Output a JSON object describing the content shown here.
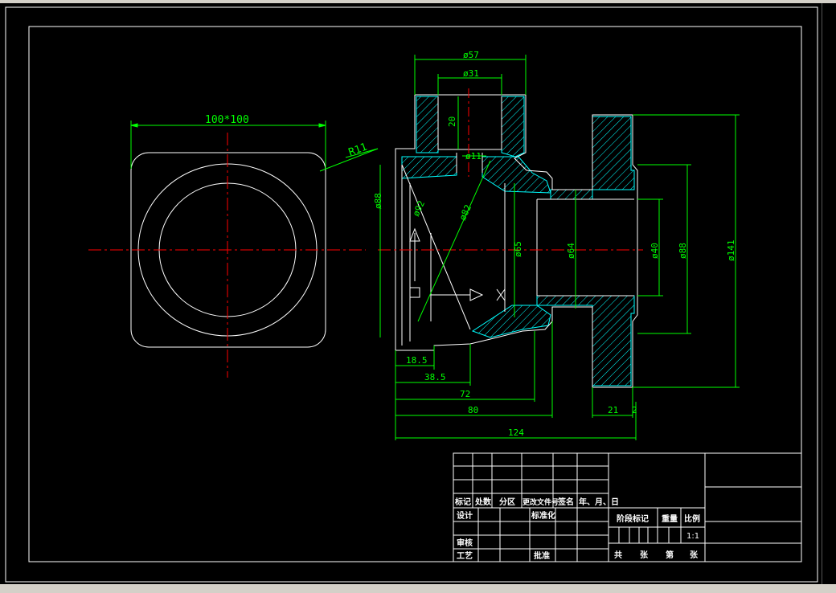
{
  "colors": {
    "background": "#000000",
    "outline": "#ffffff",
    "centerline": "#ff0000",
    "dimension": "#00ff00",
    "hatch": "#00ffff",
    "titleblock": "#ffffff",
    "chrome": "#d4d0c8"
  },
  "drawing": {
    "top_view": {
      "size_label": "100*100",
      "radius_label": "R11"
    },
    "section_view": {
      "dia_57": "ø57",
      "dia_31": "ø31",
      "depth_20": "20",
      "dia_11": "ø11",
      "dia_88_left": "ø88",
      "dia_82": "ø82",
      "dia_92": "ø92",
      "dia_65": "ø65",
      "dia_64": "ø64",
      "dia_40": "ø40",
      "dia_88_right": "ø88",
      "dia_141": "ø141",
      "len_18_5": "18.5",
      "len_38_5": "38.5",
      "len_72": "72",
      "len_80": "80",
      "len_124": "124",
      "len_21": "21",
      "len_2": "2"
    }
  },
  "titleblock": {
    "row_header": [
      "标记",
      "处数",
      "分区",
      "更改文件号",
      "签名",
      "年、月、日"
    ],
    "design": "设计",
    "standardize": "标准化",
    "review": "审核",
    "process": "工艺",
    "approve": "批准",
    "stage_mark": "阶段标记",
    "weight": "重量",
    "scale_label": "比例",
    "scale_value": "1:1",
    "sheets": [
      "共",
      "张",
      "第",
      "张"
    ]
  }
}
